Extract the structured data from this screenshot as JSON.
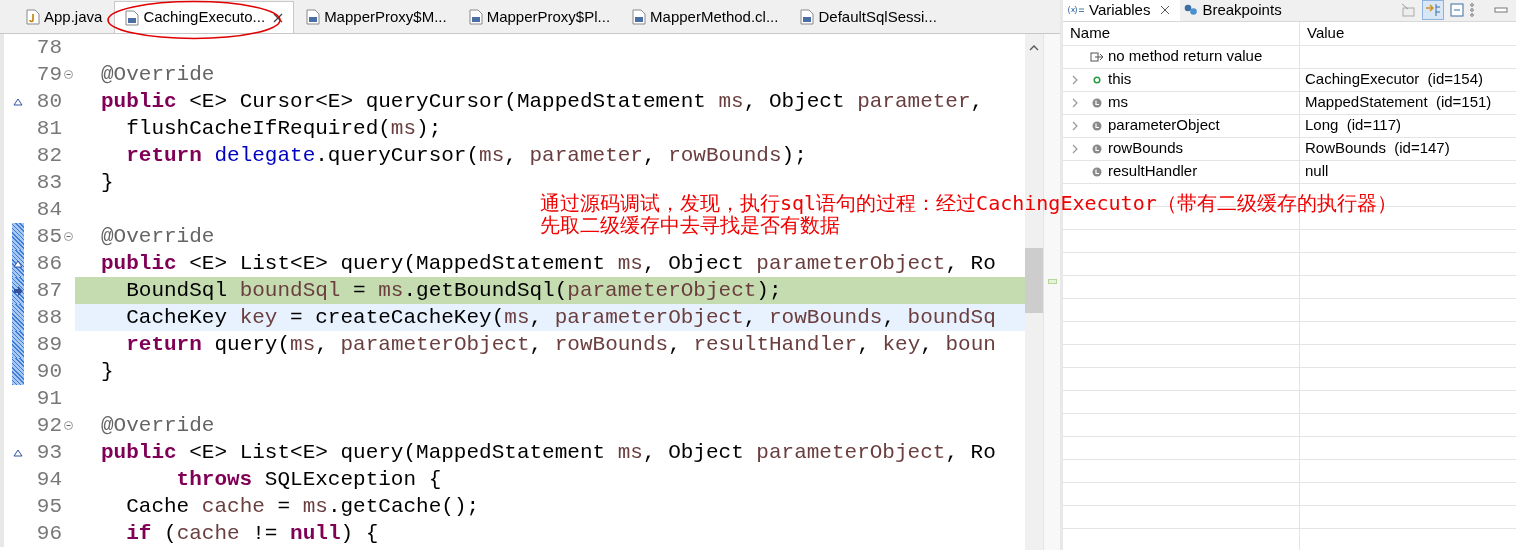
{
  "editor": {
    "tabs": [
      {
        "label": "App.java",
        "kind": "java",
        "selected": false,
        "closable": false,
        "circled": false
      },
      {
        "label": "CachingExecuto...",
        "kind": "class",
        "selected": true,
        "closable": true,
        "circled": true
      },
      {
        "label": "MapperProxy$M...",
        "kind": "class",
        "selected": false,
        "closable": false,
        "circled": false
      },
      {
        "label": "MapperProxy$Pl...",
        "kind": "class",
        "selected": false,
        "closable": false,
        "circled": false
      },
      {
        "label": "MapperMethod.cl...",
        "kind": "class",
        "selected": false,
        "closable": false,
        "circled": false
      },
      {
        "label": "DefaultSqlSessi...",
        "kind": "class",
        "selected": false,
        "closable": false,
        "circled": false
      }
    ],
    "lines": [
      {
        "number": "78",
        "fold": false,
        "override": false,
        "arrow": false,
        "range": false,
        "current": false,
        "cursor_line": false
      },
      {
        "number": "79",
        "fold": true,
        "override": false,
        "arrow": false,
        "range": false,
        "current": false,
        "cursor_line": false,
        "tokens": [
          {
            "t": "@Override",
            "kind": "ann"
          }
        ]
      },
      {
        "number": "80",
        "fold": false,
        "override": true,
        "arrow": false,
        "range": false,
        "current": false,
        "cursor_line": false,
        "tokens": [
          {
            "t": "public",
            "kind": "kw"
          },
          {
            "t": " <E> Cursor<E> queryCursor(MappedStatement ",
            "kind": "plain"
          },
          {
            "t": "ms",
            "kind": "var"
          },
          {
            "t": ", Object ",
            "kind": "plain"
          },
          {
            "t": "parameter",
            "kind": "var"
          },
          {
            "t": ",",
            "kind": "plain"
          }
        ]
      },
      {
        "number": "81",
        "fold": false,
        "override": false,
        "arrow": false,
        "range": false,
        "current": false,
        "cursor_line": false,
        "tokens": [
          {
            "t": "  flushCacheIfRequired(",
            "kind": "plain"
          },
          {
            "t": "ms",
            "kind": "var"
          },
          {
            "t": ");",
            "kind": "plain"
          }
        ]
      },
      {
        "number": "82",
        "fold": false,
        "override": false,
        "arrow": false,
        "range": false,
        "current": false,
        "cursor_line": false,
        "tokens": [
          {
            "t": "  return",
            "kind": "kw"
          },
          {
            "t": " delegate",
            "kind": "field"
          },
          {
            "t": ".queryCursor(",
            "kind": "plain"
          },
          {
            "t": "ms",
            "kind": "var"
          },
          {
            "t": ", ",
            "kind": "plain"
          },
          {
            "t": "parameter",
            "kind": "var"
          },
          {
            "t": ", ",
            "kind": "plain"
          },
          {
            "t": "rowBounds",
            "kind": "var"
          },
          {
            "t": ");",
            "kind": "plain"
          }
        ]
      },
      {
        "number": "83",
        "fold": false,
        "override": false,
        "arrow": false,
        "range": false,
        "current": false,
        "cursor_line": false,
        "tokens": [
          {
            "t": "}",
            "kind": "plain"
          }
        ]
      },
      {
        "number": "84",
        "fold": false,
        "override": false,
        "arrow": false,
        "range": false,
        "current": false,
        "cursor_line": false
      },
      {
        "number": "85",
        "fold": true,
        "override": false,
        "arrow": false,
        "range": true,
        "current": false,
        "cursor_line": false,
        "tokens": [
          {
            "t": "@Override",
            "kind": "ann"
          }
        ]
      },
      {
        "number": "86",
        "fold": false,
        "override": true,
        "arrow": false,
        "range": true,
        "current": false,
        "cursor_line": false,
        "tokens": [
          {
            "t": "public",
            "kind": "kw"
          },
          {
            "t": " <E> List<E> query(MappedStatement ",
            "kind": "plain"
          },
          {
            "t": "ms",
            "kind": "var"
          },
          {
            "t": ", Object ",
            "kind": "plain"
          },
          {
            "t": "parameterObject",
            "kind": "var"
          },
          {
            "t": ", Ro",
            "kind": "plain"
          }
        ]
      },
      {
        "number": "87",
        "fold": false,
        "override": false,
        "arrow": true,
        "range": true,
        "current": true,
        "cursor_line": false,
        "tokens": [
          {
            "t": "  BoundSql ",
            "kind": "plain"
          },
          {
            "t": "boundSql",
            "kind": "var"
          },
          {
            "t": " = ",
            "kind": "plain"
          },
          {
            "t": "ms",
            "kind": "var"
          },
          {
            "t": ".getBoundSql(",
            "kind": "plain"
          },
          {
            "t": "parameterObject",
            "kind": "var"
          },
          {
            "t": ");",
            "kind": "plain"
          }
        ]
      },
      {
        "number": "88",
        "fold": false,
        "override": false,
        "arrow": false,
        "range": true,
        "current": false,
        "cursor_line": true,
        "tokens": [
          {
            "t": "  CacheKey ",
            "kind": "plain"
          },
          {
            "t": "key",
            "kind": "var"
          },
          {
            "t": " = createCacheKey(",
            "kind": "plain"
          },
          {
            "t": "ms",
            "kind": "var"
          },
          {
            "t": ", ",
            "kind": "plain"
          },
          {
            "t": "parameterObject",
            "kind": "var"
          },
          {
            "t": ", ",
            "kind": "plain"
          },
          {
            "t": "rowBounds",
            "kind": "var"
          },
          {
            "t": ", ",
            "kind": "plain"
          },
          {
            "t": "boundSq",
            "kind": "var"
          }
        ]
      },
      {
        "number": "89",
        "fold": false,
        "override": false,
        "arrow": false,
        "range": true,
        "current": false,
        "cursor_line": false,
        "tokens": [
          {
            "t": "  return",
            "kind": "kw"
          },
          {
            "t": " query(",
            "kind": "plain"
          },
          {
            "t": "ms",
            "kind": "var"
          },
          {
            "t": ", ",
            "kind": "plain"
          },
          {
            "t": "parameterObject",
            "kind": "var"
          },
          {
            "t": ", ",
            "kind": "plain"
          },
          {
            "t": "rowBounds",
            "kind": "var"
          },
          {
            "t": ", ",
            "kind": "plain"
          },
          {
            "t": "resultHandler",
            "kind": "var"
          },
          {
            "t": ", ",
            "kind": "plain"
          },
          {
            "t": "key",
            "kind": "var"
          },
          {
            "t": ", ",
            "kind": "plain"
          },
          {
            "t": "boun",
            "kind": "var"
          }
        ]
      },
      {
        "number": "90",
        "fold": false,
        "override": false,
        "arrow": false,
        "range": true,
        "current": false,
        "cursor_line": false,
        "tokens": [
          {
            "t": "}",
            "kind": "plain"
          }
        ]
      },
      {
        "number": "91",
        "fold": false,
        "override": false,
        "arrow": false,
        "range": false,
        "current": false,
        "cursor_line": false
      },
      {
        "number": "92",
        "fold": true,
        "override": false,
        "arrow": false,
        "range": false,
        "current": false,
        "cursor_line": false,
        "tokens": [
          {
            "t": "@Override",
            "kind": "ann"
          }
        ]
      },
      {
        "number": "93",
        "fold": false,
        "override": true,
        "arrow": false,
        "range": false,
        "current": false,
        "cursor_line": false,
        "tokens": [
          {
            "t": "public",
            "kind": "kw"
          },
          {
            "t": " <E> List<E> query(MappedStatement ",
            "kind": "plain"
          },
          {
            "t": "ms",
            "kind": "var"
          },
          {
            "t": ", Object ",
            "kind": "plain"
          },
          {
            "t": "parameterObject",
            "kind": "var"
          },
          {
            "t": ", Ro",
            "kind": "plain"
          }
        ]
      },
      {
        "number": "94",
        "fold": false,
        "override": false,
        "arrow": false,
        "range": false,
        "current": false,
        "cursor_line": false,
        "tokens": [
          {
            "t": "      throws",
            "kind": "kw"
          },
          {
            "t": " SQLException {",
            "kind": "plain"
          }
        ]
      },
      {
        "number": "95",
        "fold": false,
        "override": false,
        "arrow": false,
        "range": false,
        "current": false,
        "cursor_line": false,
        "tokens": [
          {
            "t": "  Cache ",
            "kind": "plain"
          },
          {
            "t": "cache",
            "kind": "var"
          },
          {
            "t": " = ",
            "kind": "plain"
          },
          {
            "t": "ms",
            "kind": "var"
          },
          {
            "t": ".getCache();",
            "kind": "plain"
          }
        ]
      },
      {
        "number": "96",
        "fold": false,
        "override": false,
        "arrow": false,
        "range": false,
        "current": false,
        "cursor_line": false,
        "tokens": [
          {
            "t": "  if",
            "kind": "kw"
          },
          {
            "t": " (",
            "kind": "plain"
          },
          {
            "t": "cache",
            "kind": "var"
          },
          {
            "t": " != ",
            "kind": "plain"
          },
          {
            "t": "null",
            "kind": "kw"
          },
          {
            "t": ") {",
            "kind": "plain"
          }
        ]
      }
    ]
  },
  "annotation": {
    "lines": [
      "通过源码调试，发现，执行sql语句的过程：经过CachingExecutor（带有二级缓存的执行器）",
      "先取二级缓存中去寻找是否有数据"
    ]
  },
  "variables_panel": {
    "tabs": [
      {
        "label": "Variables",
        "kind": "variables",
        "selected": true,
        "closable": true
      },
      {
        "label": "Breakpoints",
        "kind": "breakpoints",
        "selected": false,
        "closable": false
      }
    ],
    "columns": [
      "Name",
      "Value"
    ],
    "rows": [
      {
        "name": "no method return value",
        "kind": "return",
        "expandable": false
      },
      {
        "name": "this",
        "value": "CachingExecutor  (id=154)",
        "kind": "field",
        "expandable": true
      },
      {
        "name": "ms",
        "value": "MappedStatement  (id=151)",
        "kind": "local",
        "expandable": true
      },
      {
        "name": "parameterObject",
        "value": "Long  (id=117)",
        "kind": "local",
        "expandable": true
      },
      {
        "name": "rowBounds",
        "value": "RowBounds  (id=147)",
        "kind": "local",
        "expandable": true
      },
      {
        "name": "resultHandler",
        "value": "null",
        "kind": "local",
        "expandable": false
      }
    ]
  }
}
